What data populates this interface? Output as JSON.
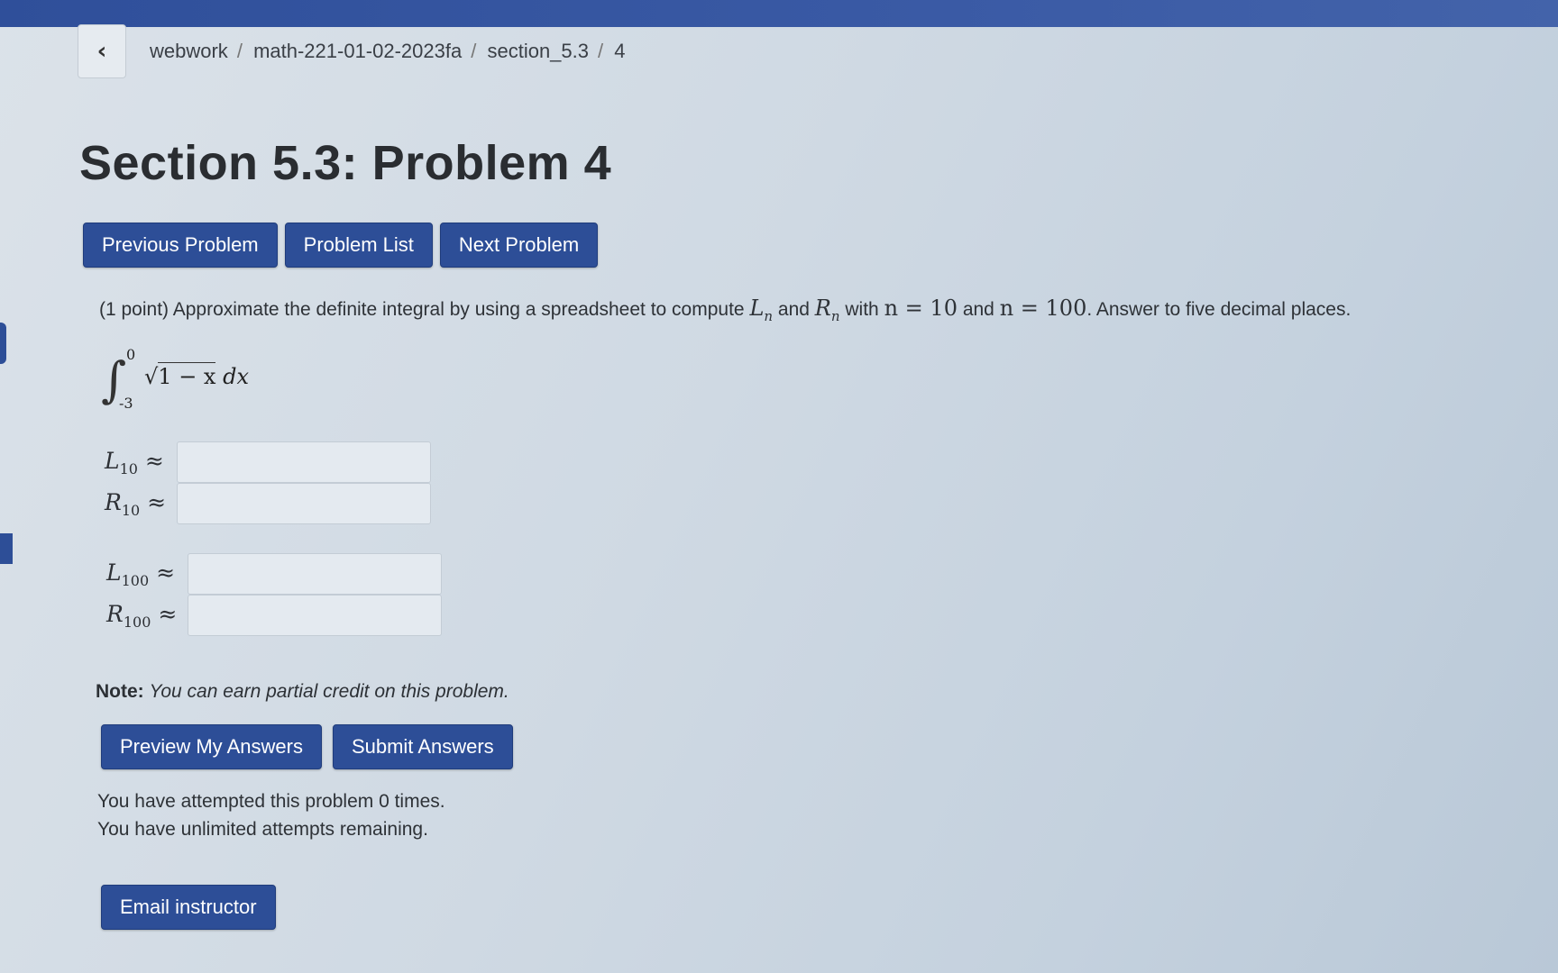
{
  "breadcrumb": {
    "back_icon": "chevron-left-icon",
    "items": [
      "webwork",
      "math-221-01-02-2023fa",
      "section_5.3",
      "4"
    ]
  },
  "title": "Section 5.3: Problem 4",
  "nav": {
    "previous": "Previous Problem",
    "list": "Problem List",
    "next": "Next Problem"
  },
  "problem": {
    "prefix": "(1 point) Approximate the definite integral by using a spreadsheet to compute",
    "Ln": "L",
    "Ln_sub": "n",
    "and1": "and",
    "Rn": "R",
    "Rn_sub": "n",
    "with": "with",
    "n_eq_10": "n = 10",
    "and2": "and",
    "n_eq_100": "n = 100",
    "suffix": ". Answer to five decimal places.",
    "integral_upper": "0",
    "integral_lower": "-3",
    "integrand_radical": "1 − x",
    "integrand_dx": "dx"
  },
  "answers": [
    {
      "letter": "L",
      "sub": "10",
      "approx": "≈",
      "value": ""
    },
    {
      "letter": "R",
      "sub": "10",
      "approx": "≈",
      "value": ""
    },
    {
      "letter": "L",
      "sub": "100",
      "approx": "≈",
      "value": ""
    },
    {
      "letter": "R",
      "sub": "100",
      "approx": "≈",
      "value": ""
    }
  ],
  "note": {
    "label": "Note:",
    "text": "You can earn partial credit on this problem."
  },
  "actions": {
    "preview": "Preview My Answers",
    "submit": "Submit Answers"
  },
  "attempts": {
    "line1": "You have attempted this problem 0 times.",
    "line2": "You have unlimited attempts remaining."
  },
  "email": "Email instructor",
  "colors": {
    "button": "#2d4e97",
    "topbar": "#3a5aa5"
  }
}
